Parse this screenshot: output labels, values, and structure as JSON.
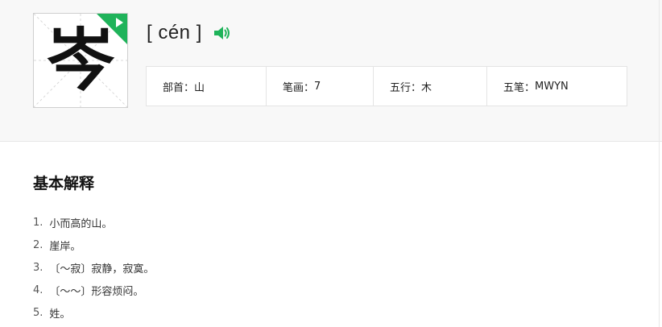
{
  "character": {
    "glyph": "岑",
    "pinyin": "[ cén ]",
    "play_icon": "play-triangle-icon",
    "sound_icon": "speaker-icon"
  },
  "attributes": [
    {
      "label": "部首：",
      "value": "山"
    },
    {
      "label": "笔画：",
      "value": "7"
    },
    {
      "label": "五行：",
      "value": "木"
    },
    {
      "label": "五笔：",
      "value": "MWYN"
    }
  ],
  "basic_explanation": {
    "title": "基本解释",
    "items": [
      {
        "num": "1.",
        "text": "小而高的山。"
      },
      {
        "num": "2.",
        "text": "崖岸。"
      },
      {
        "num": "3.",
        "text": "〔～寂〕寂静，寂寞。"
      },
      {
        "num": "4.",
        "text": "〔～～〕形容烦闷。"
      },
      {
        "num": "5.",
        "text": "姓。"
      }
    ]
  },
  "colors": {
    "accent_green": "#1fb35a",
    "panel_bg": "#f8f8f8",
    "border": "#e4e4e4"
  }
}
